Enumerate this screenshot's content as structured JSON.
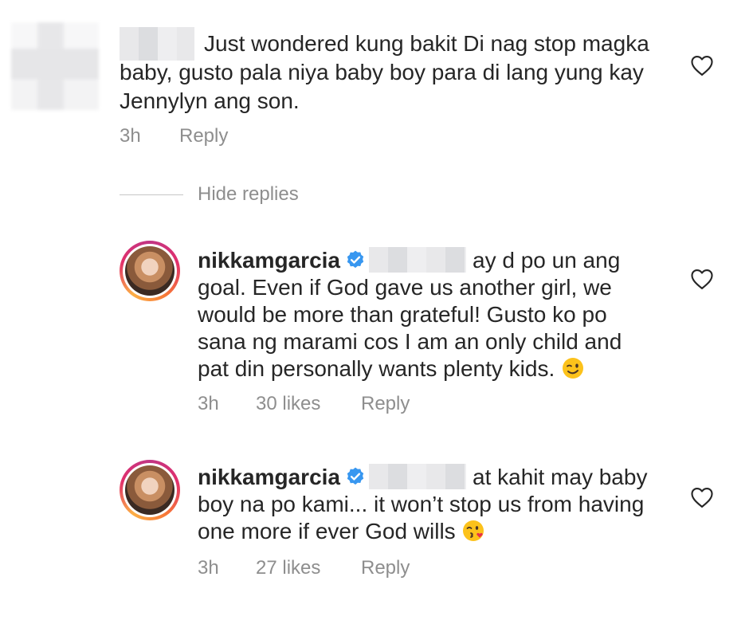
{
  "comments": [
    {
      "text_lines": [
        "Just wondered kung bakit Di nag stop magka",
        "baby, gusto pala niya baby boy para di lang yung kay",
        "Jennylyn ang son."
      ],
      "time": "3h",
      "reply_label": "Reply"
    }
  ],
  "hide_replies_label": "Hide replies",
  "replies": [
    {
      "username": "nikkamgarcia",
      "text_first": "ay d po un ang",
      "text_lines": [
        "goal. Even if God gave us another girl, we",
        "would be more than grateful! Gusto ko po",
        "sana ng marami cos I am an only child and",
        "pat din personally wants plenty kids."
      ],
      "emoji": "winking-face",
      "time": "3h",
      "likes": "30 likes",
      "reply_label": "Reply"
    },
    {
      "username": "nikkamgarcia",
      "text_first": "at kahit may baby",
      "text_lines": [
        "boy na po kami... it won’t stop us from having",
        "one more if ever God wills"
      ],
      "emoji": "face-blowing-kiss",
      "time": "3h",
      "likes": "27 likes",
      "reply_label": "Reply"
    }
  ],
  "colors": {
    "text": "#262626",
    "secondary": "#8e8e8e",
    "verified": "#3897f0"
  }
}
